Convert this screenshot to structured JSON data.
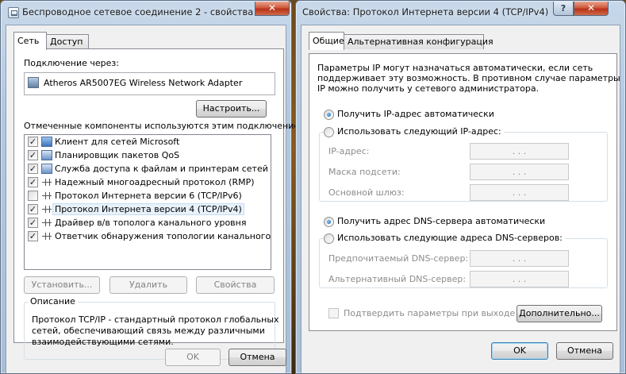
{
  "left_window": {
    "title": "Беспроводное сетевое соединение 2 - свойства",
    "close_glyph": "✕",
    "tabs": [
      "Сеть",
      "Доступ"
    ],
    "connect_using_label": "Подключение через:",
    "adapter_name": "Atheros AR5007EG Wireless Network Adapter",
    "configure_button": "Настроить...",
    "components_label": "Отмеченные компоненты используются этим подключением:",
    "components": [
      {
        "label": "Клиент для сетей Microsoft",
        "checked": true,
        "icon": "network-client-icon"
      },
      {
        "label": "Планировщик пакетов QoS",
        "checked": true,
        "icon": "network-service-icon"
      },
      {
        "label": "Служба доступа к файлам и принтерам сетей Micro...",
        "checked": true,
        "icon": "network-service-icon"
      },
      {
        "label": "Надежный многоадресный протокол (RMP)",
        "checked": true,
        "icon": "network-protocol-icon"
      },
      {
        "label": "Протокол Интернета версии 6 (TCP/IPv6)",
        "checked": false,
        "icon": "network-protocol-icon"
      },
      {
        "label": "Протокол Интернета версии 4 (TCP/IPv4)",
        "checked": true,
        "icon": "network-protocol-icon"
      },
      {
        "label": "Драйвер в/в тополога канального уровня",
        "checked": true,
        "icon": "network-protocol-icon"
      },
      {
        "label": "Ответчик обнаружения топологии канального уровня",
        "checked": true,
        "icon": "network-protocol-icon"
      }
    ],
    "install_button": "Установить...",
    "uninstall_button": "Удалить",
    "properties_button": "Свойства",
    "description_label": "Описание",
    "description_text": [
      "Протокол TCP/IP - стандартный протокол глобальных",
      "сетей, обеспечивающий связь между различными",
      "взаимодействующими сетями."
    ],
    "ok_button": "OK",
    "cancel_button": "Отмена"
  },
  "right_window": {
    "title": "Свойства: Протокол Интернета версии 4 (TCP/IPv4)",
    "help_glyph": "?",
    "close_glyph": "✕",
    "tabs": [
      "Общие",
      "Альтернативная конфигурация"
    ],
    "intro_text": [
      "Параметры IP могут назначаться автоматически, если сеть",
      "поддерживает эту возможность. В противном случае параметры",
      "IP можно получить у сетевого администратора."
    ],
    "ip_auto_label": "Получить IP-адрес автоматически",
    "ip_manual_label": "Использовать следующий IP-адрес:",
    "ip_selected": "auto",
    "ip_address_label": "IP-адрес:",
    "subnet_mask_label": "Маска подсети:",
    "gateway_label": "Основной шлюз:",
    "dns_auto_label": "Получить адрес DNS-сервера автоматически",
    "dns_manual_label": "Использовать следующие адреса DNS-серверов:",
    "dns_selected": "auto",
    "preferred_dns_label": "Предпочитаемый DNS-сервер:",
    "alternate_dns_label": "Альтернативный DNS-сервер:",
    "ip_placeholder": ".   .   .",
    "validate_label": "Подтвердить параметры при выходе",
    "advanced_button": "Дополнительно...",
    "ok_button": "OK",
    "cancel_button": "Отмена"
  }
}
